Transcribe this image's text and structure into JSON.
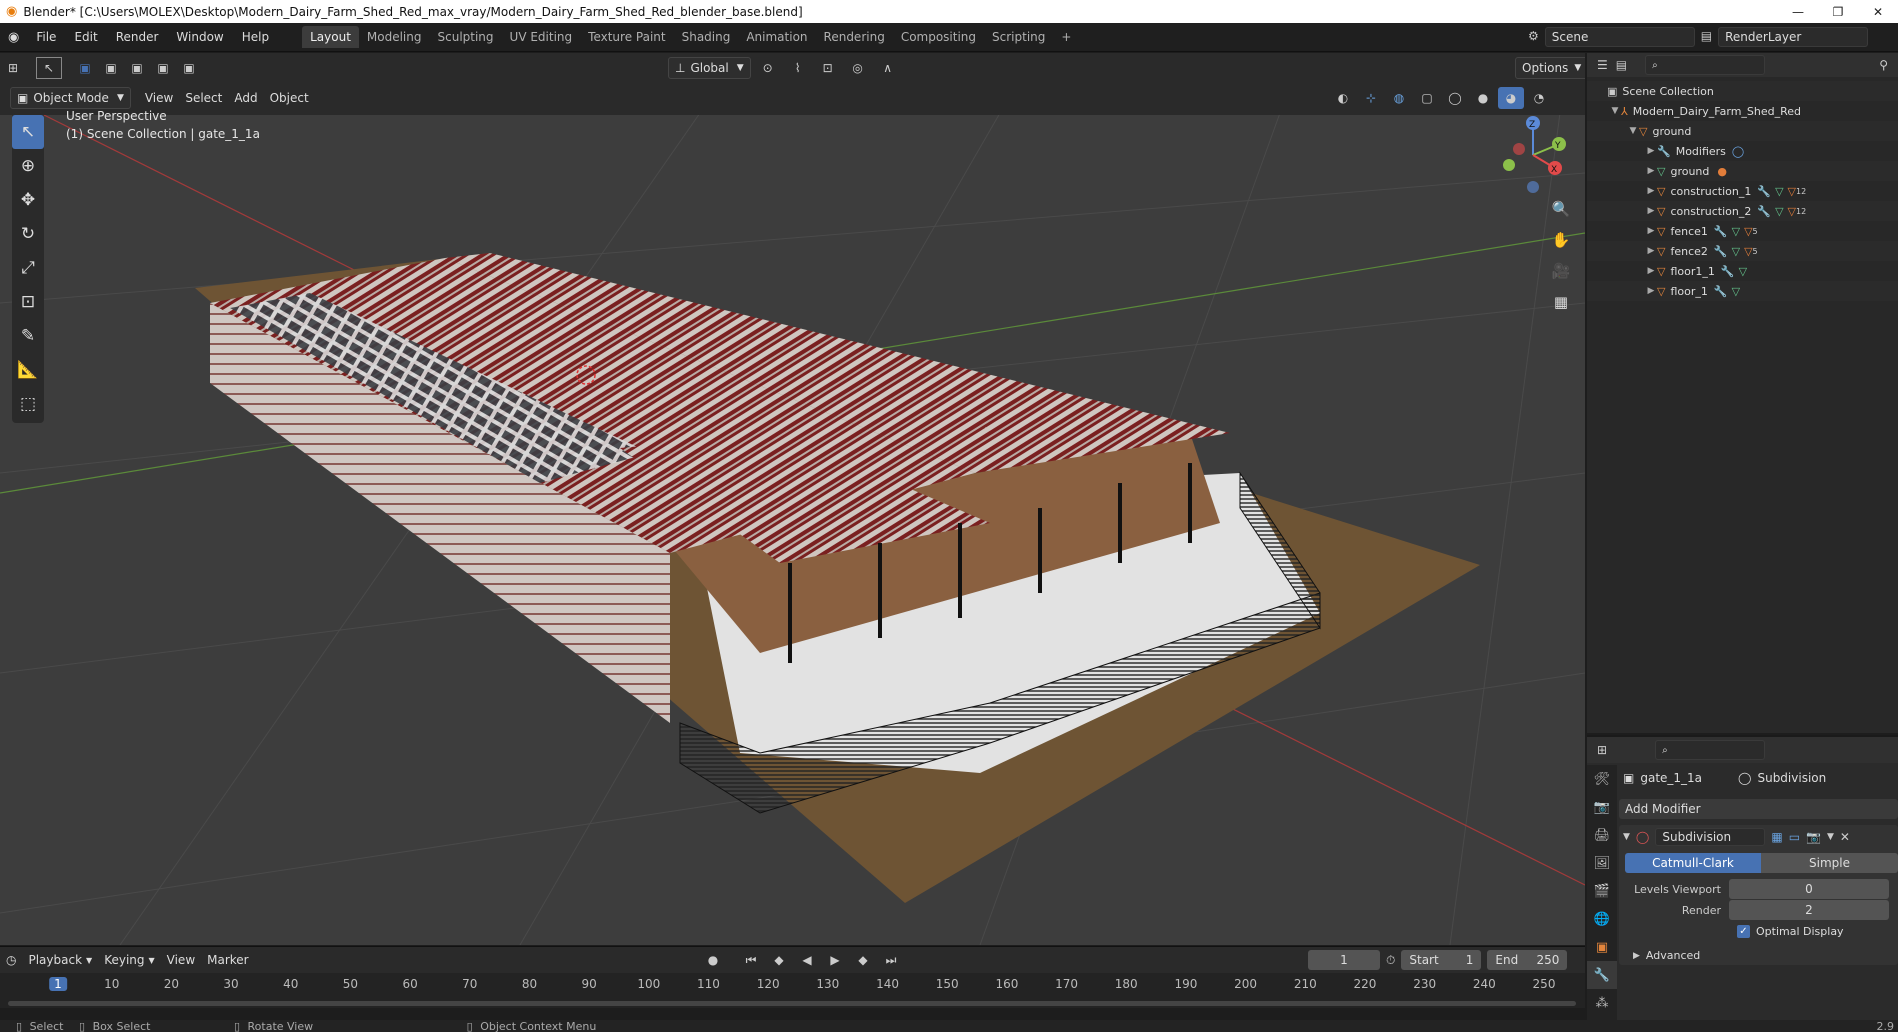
{
  "window": {
    "title": "Blender* [C:\\Users\\MOLEX\\Desktop\\Modern_Dairy_Farm_Shed_Red_max_vray/Modern_Dairy_Farm_Shed_Red_blender_base.blend]",
    "minimize": "—",
    "maximize": "❐",
    "close": "✕"
  },
  "menus": [
    "File",
    "Edit",
    "Render",
    "Window",
    "Help"
  ],
  "workspaces": [
    "Layout",
    "Modeling",
    "Sculpting",
    "UV Editing",
    "Texture Paint",
    "Shading",
    "Animation",
    "Rendering",
    "Compositing",
    "Scripting"
  ],
  "active_workspace": "Layout",
  "scene": "Scene",
  "render_layer": "RenderLayer",
  "viewport": {
    "mode": "Object Mode",
    "menus": [
      "View",
      "Select",
      "Add",
      "Object"
    ],
    "transform_orientation": "Global",
    "options": "Options",
    "perspective_label": "User Perspective",
    "collection_label": "(1) Scene Collection | gate_1_1a",
    "gizmo": {
      "z": "Z",
      "y": "Y",
      "x": "X"
    }
  },
  "outliner": {
    "root": "Scene Collection",
    "collection": "Modern_Dairy_Farm_Shed_Red",
    "parent": "ground",
    "items": [
      {
        "name": "Modifiers",
        "type": "modifiers"
      },
      {
        "name": "ground",
        "type": "mesh"
      },
      {
        "name": "construction_1",
        "type": "object",
        "mat_count": "12"
      },
      {
        "name": "construction_2",
        "type": "object",
        "mat_count": "12"
      },
      {
        "name": "fence1",
        "type": "object",
        "mat_count": "5"
      },
      {
        "name": "fence2",
        "type": "object",
        "mat_count": "5"
      },
      {
        "name": "floor1_1",
        "type": "object"
      },
      {
        "name": "floor_1",
        "type": "object"
      }
    ]
  },
  "properties": {
    "object_name": "gate_1_1a",
    "modifier_tab": "Subdivision",
    "add_modifier": "Add Modifier",
    "modifier_name": "Subdivision",
    "algo_options": [
      "Catmull-Clark",
      "Simple"
    ],
    "selected_algo": "Catmull-Clark",
    "levels_viewport_label": "Levels Viewport",
    "levels_viewport": "0",
    "render_label": "Render",
    "render": "2",
    "optimal_display": "Optimal Display",
    "advanced": "Advanced"
  },
  "timeline": {
    "menus": [
      "Playback",
      "Keying",
      "View",
      "Marker"
    ],
    "current_frame": "1",
    "start_label": "Start",
    "start": "1",
    "end_label": "End",
    "end": "250",
    "ticks": [
      "1",
      "10",
      "20",
      "30",
      "40",
      "50",
      "60",
      "70",
      "80",
      "90",
      "100",
      "110",
      "120",
      "130",
      "140",
      "150",
      "160",
      "170",
      "180",
      "190",
      "200",
      "210",
      "220",
      "230",
      "240",
      "250"
    ]
  },
  "status": {
    "select": "Select",
    "box_select": "Box Select",
    "rotate": "Rotate View",
    "context": "Object Context Menu",
    "version": "2.9"
  },
  "colors": {
    "accent": "#4772b3",
    "roof": "#7a1e1e",
    "ground": "#6e5434"
  }
}
